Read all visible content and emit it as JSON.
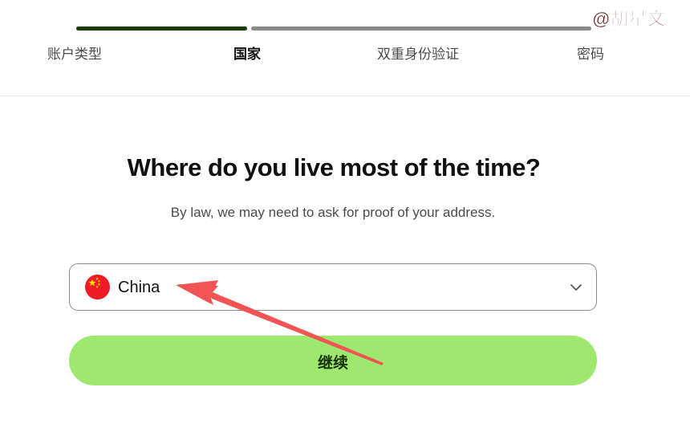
{
  "watermark": "@胡星文",
  "stepper": {
    "progress_fraction": 0.33,
    "steps": [
      {
        "label": "账户类型",
        "active": false
      },
      {
        "label": "国家",
        "active": true
      },
      {
        "label": "双重身份验证",
        "active": false
      },
      {
        "label": "密码",
        "active": false
      }
    ]
  },
  "main": {
    "title": "Where do you live most of the time?",
    "subtitle": "By law, we may need to ask for proof of your address.",
    "country_select": {
      "selected_value": "China",
      "flag_icon": "china-flag-icon",
      "dropdown_icon": "chevron-down-icon"
    },
    "continue_label": "继续"
  },
  "colors": {
    "accent": "#9fe870",
    "button_text": "#163300",
    "progress_done": "#1b3a07",
    "progress_todo": "#8a8a8a",
    "annotation": "#f05454"
  }
}
